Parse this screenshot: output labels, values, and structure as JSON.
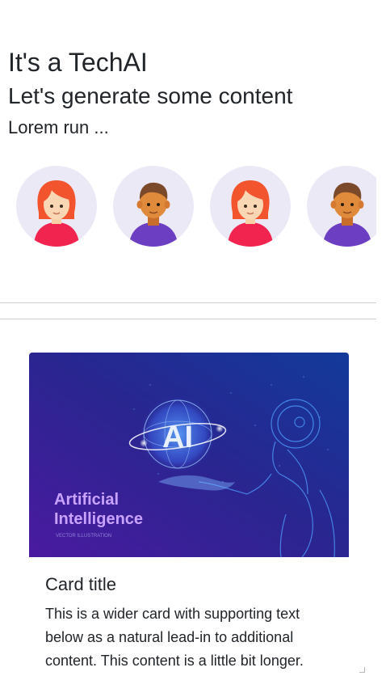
{
  "hero": {
    "title": "It's a TechAI",
    "subtitle": "Let's generate some content",
    "lead": "Lorem run ..."
  },
  "avatars": [
    {
      "icon": "female-avatar-icon"
    },
    {
      "icon": "male-avatar-icon"
    },
    {
      "icon": "female-avatar-icon"
    },
    {
      "icon": "male-avatar-icon"
    }
  ],
  "card": {
    "image": {
      "badge": "AI",
      "headline_line1": "Artificial",
      "headline_line2": "Intelligence",
      "caption": "VECTOR ILLUSTRATION"
    },
    "title": "Card title",
    "text": "This is a wider card with supporting text below as a natural lead-in to additional content. This content is a little bit longer."
  },
  "colors": {
    "avatar_bg": "#ece9f6",
    "female_hair": "#f2542d",
    "female_shirt": "#f0244f",
    "male_hair": "#7a4a2a",
    "male_shirt": "#6c3fc2",
    "card_image_bg": "#2b1f8f"
  }
}
